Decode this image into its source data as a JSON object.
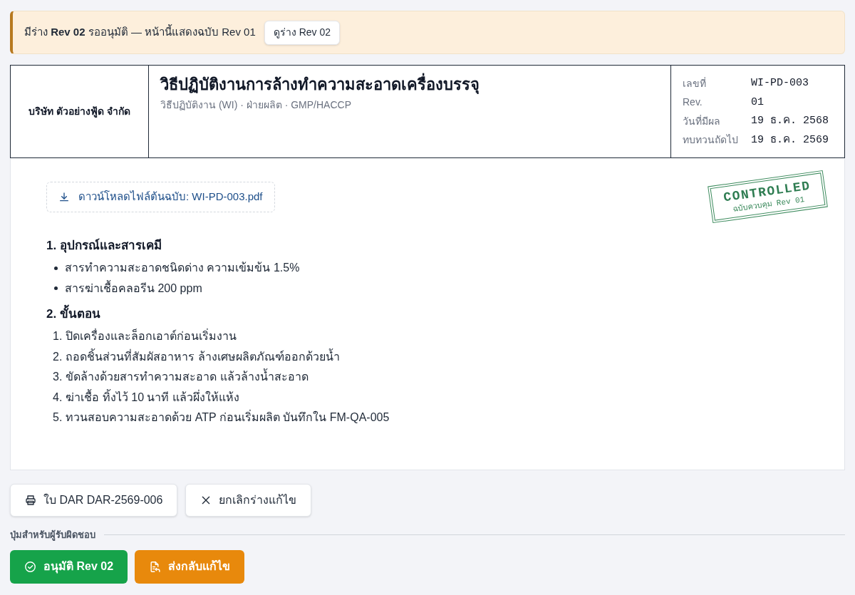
{
  "banner": {
    "message": "มีร่าง **Rev 02** รออนุมัติ — หน้านี้แสดงฉบับ Rev 01",
    "button": "ดูร่าง Rev 02"
  },
  "document_header": {
    "company": "บริษัท ตัวอย่างฟู้ด จำกัด",
    "title": "วิธีปฏิบัติงานการล้างทำความสะอาดเครื่องบรรจุ",
    "subtitle": "วิธีปฏิบัติงาน (WI) · ฝ่ายผลิต · GMP/HACCP",
    "meta": [
      {
        "label": "เลขที่",
        "value": "WI-PD-003"
      },
      {
        "label": "Rev.",
        "value": "01"
      },
      {
        "label": "วันที่มีผล",
        "value": "19 ธ.ค. 2568"
      },
      {
        "label": "ทบทวนถัดไป",
        "value": "19 ธ.ค. 2569"
      }
    ]
  },
  "document_body": {
    "download_link": "ดาวน์โหลดไฟล์ต้นฉบับ: WI-PD-003.pdf",
    "stamp": {
      "title": "CONTROLLED",
      "subtitle": "ฉบับควบคุม Rev 01"
    },
    "sections": [
      {
        "heading": "1. อุปกรณ์และสารเคมี",
        "kind": "bullets",
        "items": [
          {
            "text": "สารทำความสะอาดชนิดด่าง ความเข้มข้น 1.5%"
          },
          {
            "text": "สารฆ่าเชื้อคลอรีน 200 ppm"
          }
        ]
      },
      {
        "heading": "2. ขั้นตอน",
        "kind": "numbered",
        "items": [
          {
            "number": "1.",
            "text": "ปิดเครื่องและล็อกเอาต์ก่อนเริ่มงาน"
          },
          {
            "number": "2.",
            "text": "ถอดชิ้นส่วนที่สัมผัสอาหาร ล้างเศษผลิตภัณฑ์ออกด้วยน้ำ"
          },
          {
            "number": "3.",
            "text": "ขัดล้างด้วยสารทำความสะอาด แล้วล้างน้ำสะอาด"
          },
          {
            "number": "4.",
            "text": "ฆ่าเชื้อ ทิ้งไว้ 10 นาที แล้วผึ่งให้แห้ง"
          },
          {
            "number": "5.",
            "text": "ทวนสอบความสะอาดด้วย ATP ก่อนเริ่มผลิต บันทึกใน FM-QA-005"
          }
        ]
      }
    ]
  },
  "actions": [
    {
      "label": "ใบ DAR DAR-2569-006"
    },
    {
      "label": "ยกเลิกร่างแก้ไข"
    }
  ],
  "responsible_actions": {
    "label": "ปุ่มสำหรับผู้รับผิดชอบ",
    "buttons": [
      {
        "label": "อนุมัติ Rev 02",
        "color": "#16a34a"
      },
      {
        "label": "ส่งกลับแก้ไข",
        "color": "#e8890c"
      }
    ]
  }
}
